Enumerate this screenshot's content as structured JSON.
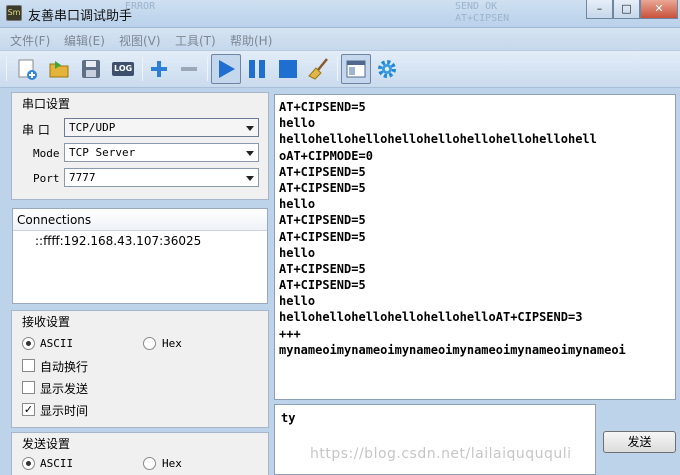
{
  "window": {
    "title": "友善串口调试助手",
    "bg_faint_1": "ERROR",
    "bg_faint_2": "AT+CIPSEN",
    "bg_faint_3": "SEND OK",
    "bg_faint_4": "AT+CIPSEN",
    "icon_text": "Sm"
  },
  "menu": {
    "items": [
      "文件(F)",
      "编辑(E)",
      "视图(V)",
      "工具(T)",
      "帮助(H)"
    ]
  },
  "toolbar": {
    "log_label": "LOG"
  },
  "serial_settings": {
    "title": "串口设置",
    "port_label": "串  口",
    "port_value": "TCP/UDP",
    "mode_label": "Mode",
    "mode_value": "TCP Server",
    "portnum_label": "Port",
    "portnum_value": "7777"
  },
  "connections": {
    "header": "Connections",
    "rows": [
      "::ffff:192.168.43.107:36025"
    ]
  },
  "receive_settings": {
    "title": "接收设置",
    "ascii_label": "ASCII",
    "hex_label": "Hex",
    "auto_wrap_label": "自动换行",
    "show_send_label": "显示发送",
    "show_time_label": "显示时间",
    "show_time_mark": "✓"
  },
  "send_settings": {
    "title": "发送设置",
    "ascii_label": "ASCII",
    "hex_label": "Hex"
  },
  "receive_area": {
    "lines": [
      "AT+CIPSEND=5",
      "hello",
      "hellohellohellohellohellohellohellohellohell",
      "oAT+CIPMODE=0",
      "AT+CIPSEND=5",
      "AT+CIPSEND=5",
      "hello",
      "AT+CIPSEND=5",
      "AT+CIPSEND=5",
      "hello",
      "AT+CIPSEND=5",
      "AT+CIPSEND=5",
      "hello",
      "hellohellohellohellohellohelloAT+CIPSEND=3",
      "+++",
      "mynameoimynameoimynameoimynameoimynameoimynameoi"
    ]
  },
  "send_area": {
    "value": "ty",
    "button_label": "发送"
  },
  "watermark": "https://blog.csdn.net/lailaiquququli"
}
